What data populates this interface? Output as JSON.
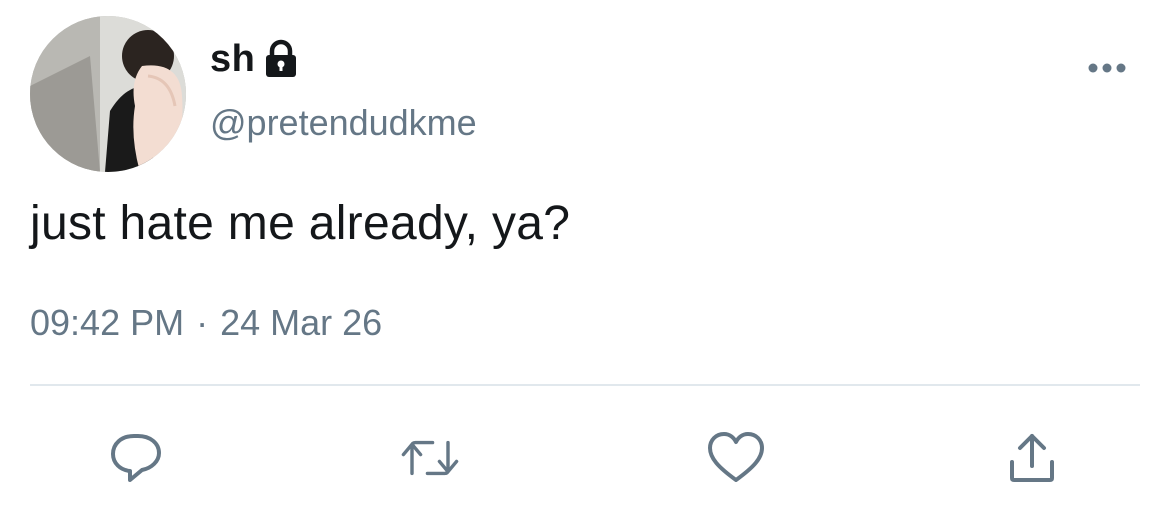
{
  "user": {
    "display_name": "sh",
    "handle": "@pretendudkme",
    "avatar_icon": "profile-photo"
  },
  "tweet": {
    "text": "just hate me already, ya?",
    "time": "09:42 PM",
    "separator": "·",
    "date": "24 Mar 26"
  },
  "icons": {
    "lock": "lock-icon",
    "more": "more-dots-icon",
    "reply": "reply-icon",
    "retweet": "retweet-icon",
    "like": "heart-icon",
    "share": "share-icon"
  },
  "colors": {
    "text": "#14171a",
    "muted": "#657786",
    "divider": "#e1e8ed"
  }
}
